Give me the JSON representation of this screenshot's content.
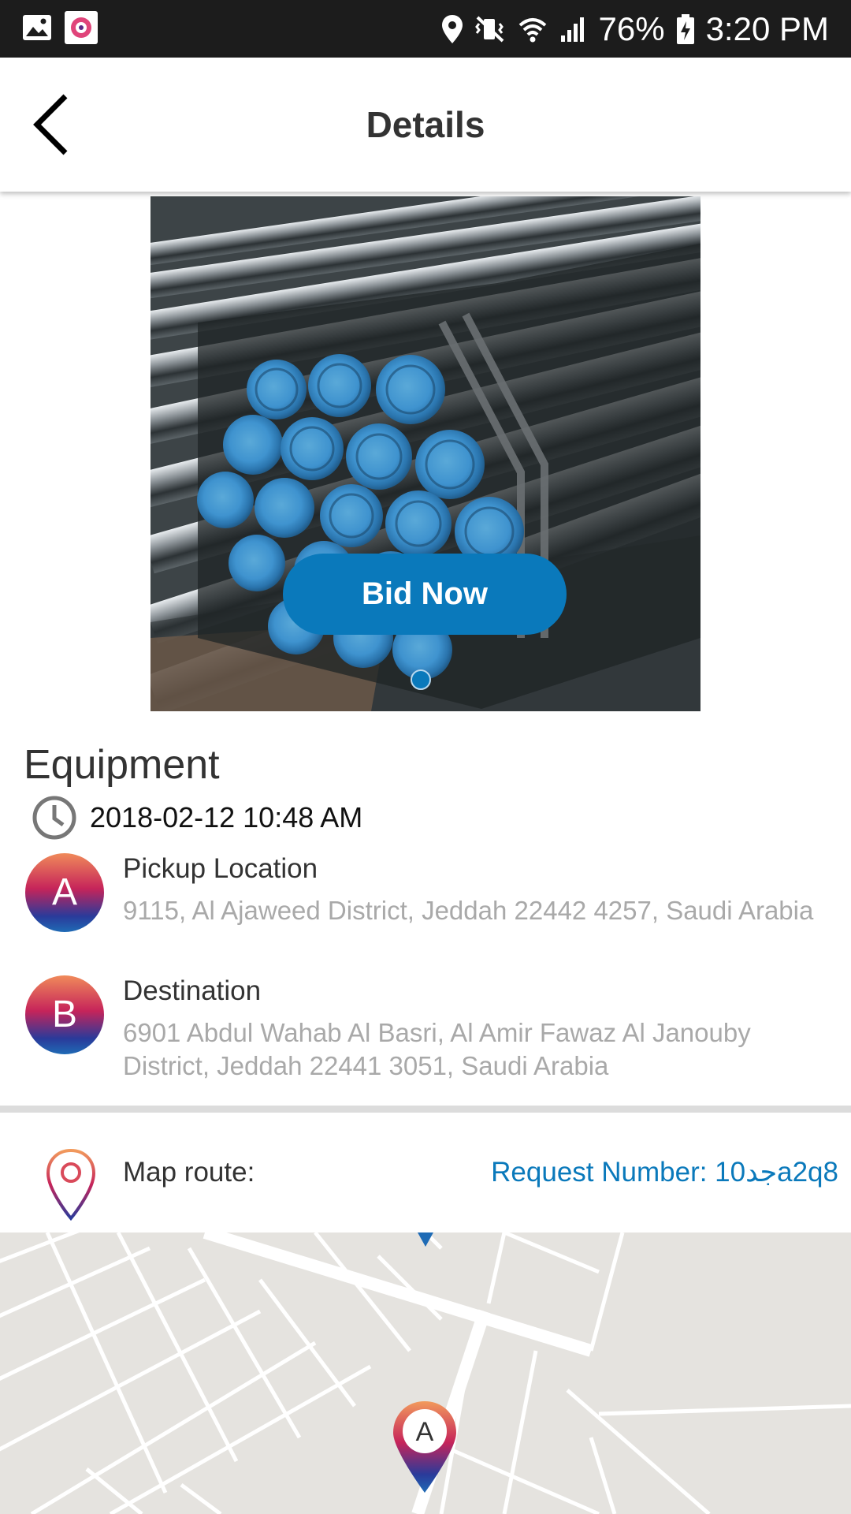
{
  "status_bar": {
    "battery": "76%",
    "time": "3:20 PM"
  },
  "header": {
    "title": "Details"
  },
  "product": {
    "bid_button": "Bid Now",
    "title": "Equipment",
    "datetime": "2018-02-12 10:48 AM"
  },
  "pickup": {
    "badge": "A",
    "label": "Pickup Location",
    "address": "9115, Al Ajaweed District, Jeddah 22442 4257, Saudi Arabia"
  },
  "destination": {
    "badge": "B",
    "label": "Destination",
    "address": "6901 Abdul Wahab Al Basri, Al Amir Fawaz Al Janouby District, Jeddah 22441 3051, Saudi Arabia"
  },
  "map_route": {
    "label": "Map route:",
    "request_number": "Request Number: 10جدa2q8"
  },
  "map": {
    "marker_label": "A"
  },
  "colors": {
    "accent": "#0a79bb",
    "status_bar": "#1c1c1c",
    "address_gray": "#a9a9a9"
  }
}
